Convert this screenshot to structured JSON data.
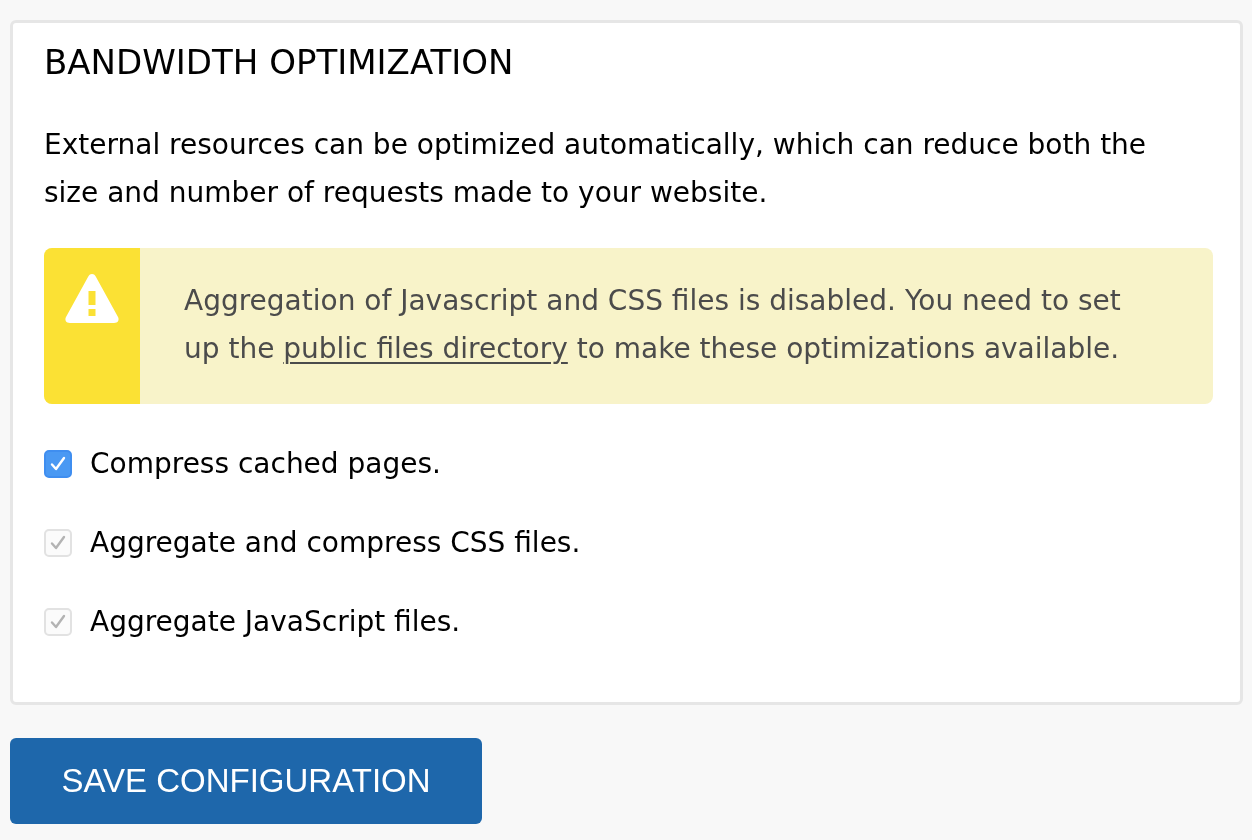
{
  "section": {
    "title": "BANDWIDTH OPTIMIZATION",
    "description": "External resources can be optimized automatically, which can reduce both the size and number of requests made to your website."
  },
  "warning": {
    "text_before": "Aggregation of Javascript and CSS files is disabled. You need to set up the ",
    "link": "public files directory",
    "text_after": " to make these optimizations available."
  },
  "options": [
    {
      "label": "Compress cached pages.",
      "checked": true,
      "disabled": false
    },
    {
      "label": "Aggregate and compress CSS files.",
      "checked": true,
      "disabled": true
    },
    {
      "label": "Aggregate JavaScript files.",
      "checked": true,
      "disabled": true
    }
  ],
  "buttons": [
    {
      "label": "SAVE CONFIGURATION"
    }
  ]
}
